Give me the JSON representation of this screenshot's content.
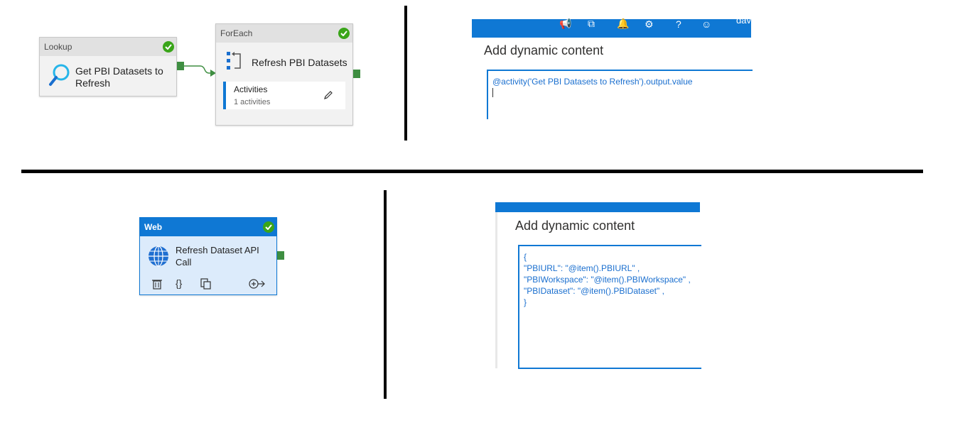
{
  "lookup": {
    "header": "Lookup",
    "title_line1": "Get PBI Datasets to",
    "title_line2": "Refresh"
  },
  "foreach": {
    "header": "ForEach",
    "title": "Refresh PBI Datasets",
    "activities_label": "Activities",
    "activities_count": "1 activities"
  },
  "web": {
    "header": "Web",
    "title_line1": "Refresh Dataset API",
    "title_line2": "Call",
    "json_braces": "{}"
  },
  "panel_top": {
    "title": "Add dynamic content",
    "user_text": "dav",
    "expression": "@activity('Get PBI Datasets to Refresh').output.value"
  },
  "panel_bottom": {
    "title": "Add dynamic content",
    "lines": [
      "{",
      "\"PBIURL\": \"@item().PBIURL\" ,",
      "\"PBIWorkspace\": \"@item().PBIWorkspace\" ,",
      "\"PBIDataset\": \"@item().PBIDataset\" ,",
      "}"
    ]
  },
  "colors": {
    "accent": "#0f78d4",
    "success": "#3aa519",
    "port": "#3e8e41",
    "web_card_bg": "#dcebfb"
  }
}
